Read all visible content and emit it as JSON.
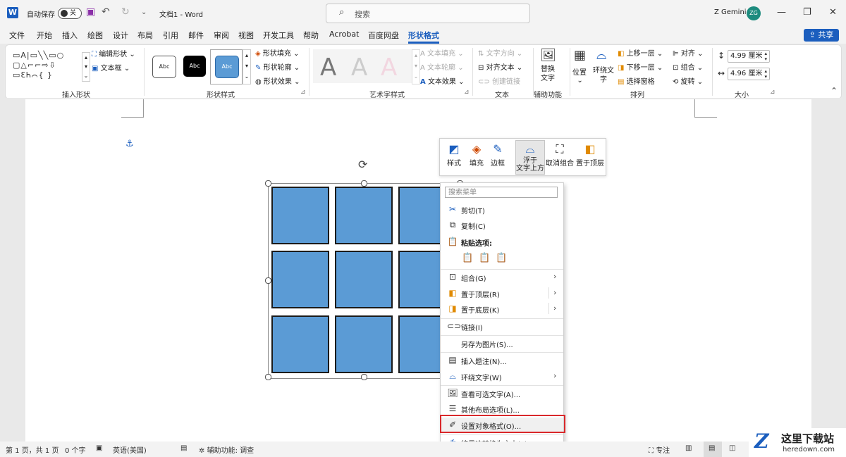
{
  "titlebar": {
    "app_icon": "word-icon",
    "autosave_label": "自动保存",
    "autosave_state": "关",
    "doc_title": "文档1 - Word",
    "search_placeholder": "搜索",
    "user_name": "Z Gemini",
    "user_initials": "ZG"
  },
  "tabs": [
    "文件",
    "开始",
    "插入",
    "绘图",
    "设计",
    "布局",
    "引用",
    "邮件",
    "审阅",
    "视图",
    "开发工具",
    "帮助",
    "Acrobat",
    "百度网盘",
    "形状格式"
  ],
  "share_label": "共享",
  "ribbon": {
    "insert_shapes": {
      "label": "插入形状",
      "edit_shape": "编辑形状",
      "text_box": "文本框",
      "shape_rows": [
        "▭A|▭╲╲▭○",
        "▢△⌐⌐⇨⇩",
        "▭ƐᏂ⌒{ }"
      ]
    },
    "shape_styles": {
      "label": "形状样式",
      "swatch_label": "Abc",
      "fill": "形状填充",
      "outline": "形状轮廓",
      "effects": "形状效果"
    },
    "wordart": {
      "label": "艺术字样式",
      "glyph": "A",
      "text_fill": "文本填充",
      "text_outline": "文本轮廓",
      "text_effects": "文本效果"
    },
    "text": {
      "label": "文本",
      "direction": "文字方向",
      "align": "对齐文本",
      "link": "创建链接"
    },
    "accessibility": {
      "label": "辅助功能",
      "alt_text_line1": "替换",
      "alt_text_line2": "文字"
    },
    "arrange": {
      "label": "排列",
      "position": "位置",
      "wrap_line1": "环绕文",
      "wrap_line2": "字",
      "bring_forward": "上移一层",
      "send_backward": "下移一层",
      "selection_pane": "选择窗格",
      "align": "对齐",
      "group": "组合",
      "rotate": "旋转"
    },
    "size": {
      "label": "大小",
      "height": "4.99 厘米",
      "width": "4.96 厘米"
    }
  },
  "minibar": [
    {
      "label": "样式",
      "icon": "style-icon"
    },
    {
      "label": "填充",
      "icon": "fill-icon"
    },
    {
      "label": "边框",
      "icon": "border-icon"
    },
    {
      "label_line1": "浮于",
      "label_line2": "文字上方",
      "icon": "in-front-of-text-icon"
    },
    {
      "label": "取消组合",
      "icon": "ungroup-icon"
    },
    {
      "label": "置于顶层",
      "icon": "bring-to-front-icon"
    }
  ],
  "context_menu": {
    "search_placeholder": "搜索菜单",
    "cut": "剪切(T)",
    "copy": "复制(C)",
    "paste_options": "粘贴选项:",
    "group": "组合(G)",
    "bring_to_front": "置于顶层(R)",
    "send_to_back": "置于底层(K)",
    "link": "链接(I)",
    "save_as_picture": "另存为图片(S)...",
    "insert_caption": "插入题注(N)...",
    "wrap_text": "环绕文字(W)",
    "view_alt_text": "查看可选文字(A)...",
    "more_layout": "其他布局选项(L)...",
    "format_object": "设置对象格式(O)...",
    "convert_ink": "将墨迹转换为文本(T)"
  },
  "statusbar": {
    "page": "第 1 页，共 1 页",
    "words": "0 个字",
    "language": "英语(美国)",
    "accessibility": "辅助功能: 调查",
    "focus": "专注"
  },
  "watermark": {
    "logo_letter": "Z",
    "name": "这里下载站",
    "url": "heredown.com"
  },
  "colors": {
    "accent": "#1b5ebe",
    "shape_fill": "#5b9bd5",
    "highlight": "#d9282b"
  }
}
